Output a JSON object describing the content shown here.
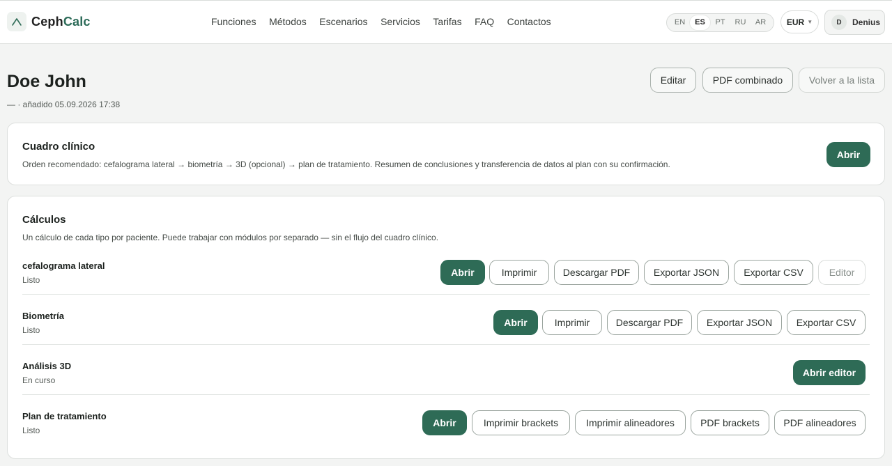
{
  "brand": {
    "name_part1": "Ceph",
    "name_part2": "Calc",
    "logo_icon": "chevron-up-icon"
  },
  "nav": [
    "Funciones",
    "Métodos",
    "Escenarios",
    "Servicios",
    "Tarifas",
    "FAQ",
    "Contactos"
  ],
  "languages": [
    {
      "code": "EN",
      "active": false
    },
    {
      "code": "ES",
      "active": true
    },
    {
      "code": "PT",
      "active": false
    },
    {
      "code": "RU",
      "active": false
    },
    {
      "code": "AR",
      "active": false
    }
  ],
  "currency": "EUR",
  "user": {
    "initial": "D",
    "name": "Denius"
  },
  "patient": {
    "name": "Doe John",
    "subtitle": "— · añadido 05.09.2026 17:38"
  },
  "header_actions": {
    "edit": "Editar",
    "pdf": "PDF combinado",
    "back": "Volver a la lista"
  },
  "clinical": {
    "title": "Cuadro clínico",
    "description": "Orden recomendado: cefalograma lateral → biometría → 3D (opcional) → plan de tratamiento. Resumen de conclusiones y transferencia de datos al plan con su confirmación.",
    "open": "Abrir"
  },
  "calculations": {
    "title": "Cálculos",
    "description": "Un cálculo de cada tipo por paciente. Puede trabajar con módulos por separado — sin el flujo del cuadro clínico.",
    "rows": [
      {
        "title": "cefalograma lateral",
        "status": "Listo",
        "buttons": [
          "Abrir",
          "Imprimir",
          "Descargar PDF",
          "Exportar JSON",
          "Exportar CSV",
          "Editor"
        ]
      },
      {
        "title": "Biometría",
        "status": "Listo",
        "buttons": [
          "Abrir",
          "Imprimir",
          "Descargar PDF",
          "Exportar JSON",
          "Exportar CSV"
        ]
      },
      {
        "title": "Análisis 3D",
        "status": "En curso",
        "buttons": [
          "Abrir editor"
        ]
      },
      {
        "title": "Plan de tratamiento",
        "status": "Listo",
        "buttons": [
          "Abrir",
          "Imprimir brackets",
          "Imprimir alineadores",
          "PDF brackets",
          "PDF alineadores"
        ]
      }
    ]
  },
  "colors": {
    "primary": "#2e6b56",
    "background": "#f3f4f3"
  }
}
